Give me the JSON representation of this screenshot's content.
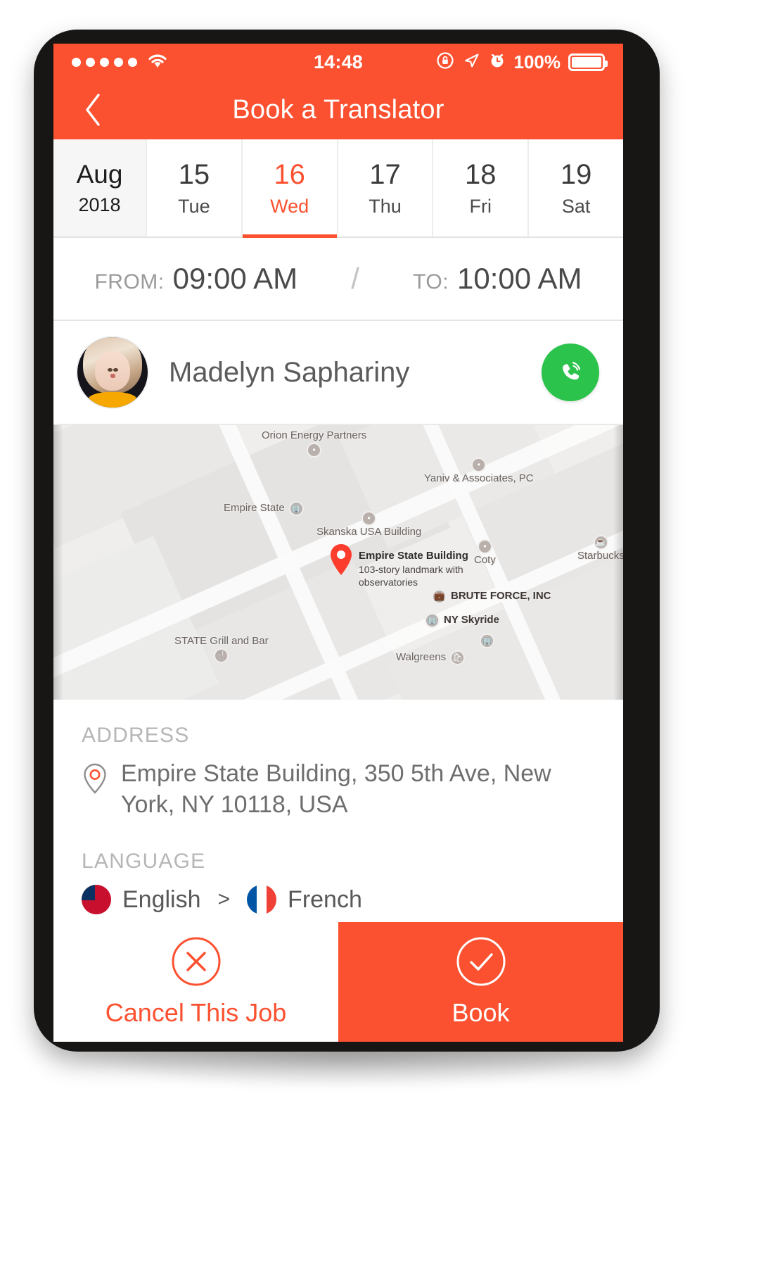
{
  "statusbar": {
    "signal_dots": 5,
    "wifi_icon": "wifi-icon",
    "time": "14:48",
    "rotation_lock_icon": "rotation-lock-icon",
    "location_icon": "location-arrow-icon",
    "alarm_icon": "alarm-clock-icon",
    "battery_percent": "100%",
    "battery_icon": "battery-full-icon"
  },
  "navbar": {
    "back_icon": "chevron-left-icon",
    "title": "Book a Translator"
  },
  "dates": {
    "month_label": "Aug",
    "year_label": "2018",
    "days": [
      {
        "num": "15",
        "name": "Tue",
        "active": false
      },
      {
        "num": "16",
        "name": "Wed",
        "active": true
      },
      {
        "num": "17",
        "name": "Thu",
        "active": false
      },
      {
        "num": "18",
        "name": "Fri",
        "active": false
      },
      {
        "num": "19",
        "name": "Sat",
        "active": false
      }
    ]
  },
  "time_range": {
    "from_label": "FROM:",
    "from_value": "09:00 AM",
    "separator": "/",
    "to_label": "TO:",
    "to_value": "10:00 AM"
  },
  "translator": {
    "avatar_icon": "avatar",
    "name": "Madelyn Saphariny",
    "call_icon": "phone-call-icon"
  },
  "map": {
    "marker_icon": "map-pin-icon",
    "marker_title": "Empire State Building",
    "marker_subtitle": "103-story landmark with observatories",
    "pois": [
      {
        "label": "Orion Energy Partners",
        "icon": "dot-poi-icon"
      },
      {
        "label": "Yaniv & Associates, PC",
        "icon": "dot-poi-icon"
      },
      {
        "label": "Empire State",
        "icon": "landmark-poi-icon"
      },
      {
        "label": "Skanska USA Building",
        "icon": "dot-poi-icon"
      },
      {
        "label": "Coty",
        "icon": "dot-poi-icon"
      },
      {
        "label": "Starbucks",
        "icon": "cup-poi-icon"
      },
      {
        "label": "BRUTE FORCE, INC",
        "icon": "bag-poi-icon"
      },
      {
        "label": "NY Skyride",
        "icon": "landmark-poi-icon"
      },
      {
        "label": "STATE Grill and Bar",
        "icon": "restaurant-poi-icon"
      },
      {
        "label": "Walgreens",
        "icon": "shop-poi-icon"
      }
    ]
  },
  "address": {
    "section_label": "ADDRESS",
    "pin_icon": "location-pin-icon",
    "value": "Empire State Building, 350 5th Ave, New York, NY 10118, USA"
  },
  "language": {
    "section_label": "LANGUAGE",
    "source_flag": "flag-us-icon",
    "source": "English",
    "arrow": ">",
    "target_flag": "flag-fr-icon",
    "target": "French"
  },
  "actions": {
    "cancel_icon": "circle-x-icon",
    "cancel_label": "Cancel This Job",
    "book_icon": "circle-check-icon",
    "book_label": "Book"
  },
  "colors": {
    "accent": "#fc5130",
    "call_green": "#2bc34b",
    "text_muted": "#b6b6b6"
  }
}
